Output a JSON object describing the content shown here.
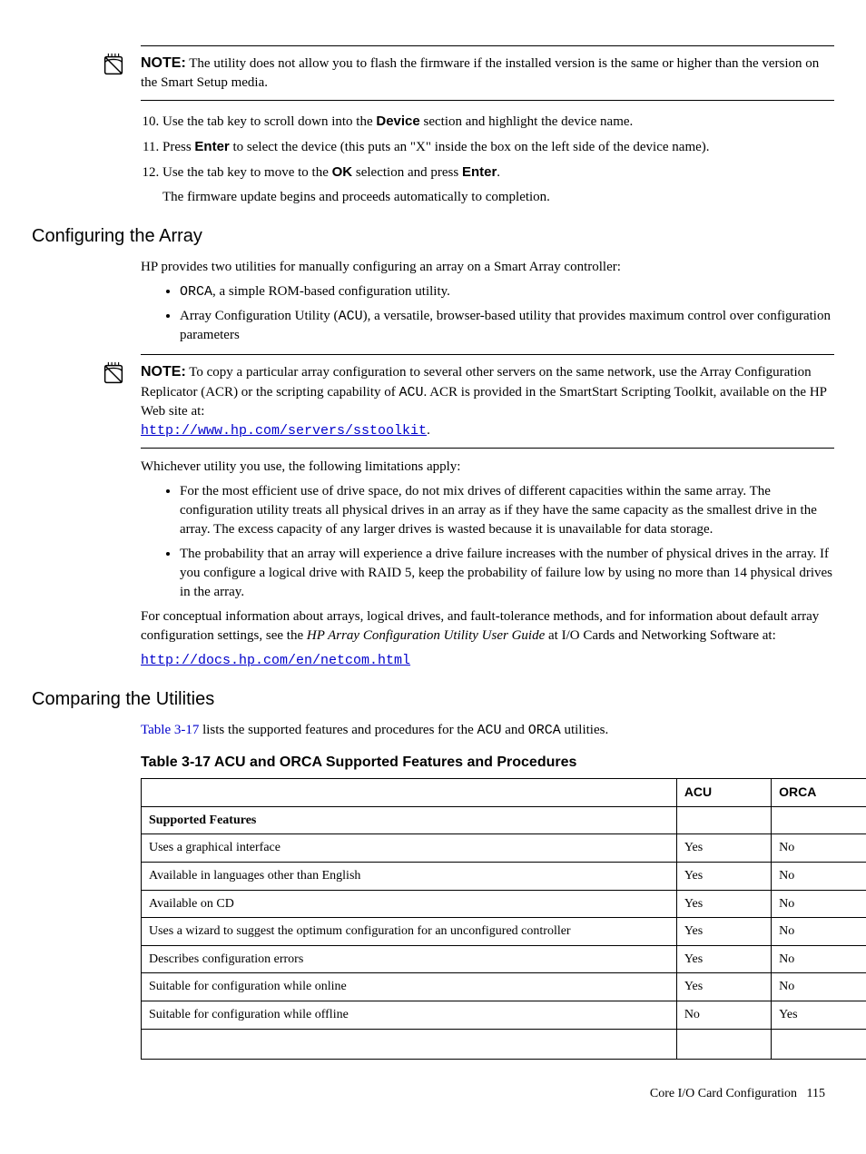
{
  "note1": {
    "label": "NOTE:",
    "text": "The utility does not allow you to flash the firmware if the installed version is the same or higher than the version on the Smart Setup media."
  },
  "steps": {
    "start": 10,
    "s10_a": "Use the tab key to scroll down into the ",
    "s10_bold": "Device",
    "s10_b": " section and highlight the device name.",
    "s11_a": "Press ",
    "s11_bold": "Enter",
    "s11_b": " to select the device (this puts an \"X\" inside the box on the left side of the device name).",
    "s12_a": "Use the tab key to move to the ",
    "s12_bold1": "OK",
    "s12_b": " selection and press ",
    "s12_bold2": "Enter",
    "s12_c": ".",
    "s12_sub": "The firmware update begins and proceeds automatically to completion."
  },
  "section1": {
    "heading": "Configuring the Array",
    "intro": "HP provides two utilities for manually configuring an array on a Smart Array controller:",
    "b1_mono": "ORCA",
    "b1_rest": ", a simple ROM-based configuration utility.",
    "b2_a": "Array Configuration Utility (",
    "b2_mono": "ACU",
    "b2_b": "), a versatile, browser-based utility that provides maximum control over configuration parameters"
  },
  "note2": {
    "label": "NOTE:",
    "text_a": "To copy a particular array configuration to several other servers on the same network, use the Array Configuration Replicator (ACR) or the scripting capability of ",
    "mono": "ACU",
    "text_b": ". ACR is provided in the SmartStart Scripting Toolkit, available on the HP Web site at:",
    "link": "http://www.hp.com/servers/sstoolkit",
    "period": "."
  },
  "limits": {
    "intro": "Whichever utility you use, the following limitations apply:",
    "b1": "For the most efficient use of drive space, do not mix drives of different capacities within the same array. The configuration utility treats all physical drives in an array as if they have the same capacity as the smallest drive in the array. The excess capacity of any larger drives is wasted because it is unavailable for data storage.",
    "b2": "The probability that an array will experience a drive failure increases with the number of physical drives in the array. If you configure a logical drive with RAID 5, keep the probability of failure low by using no more than 14 physical drives in the array.",
    "concept_a": "For conceptual information about arrays, logical drives, and fault-tolerance methods, and for information about default array configuration settings, see the ",
    "concept_italic": "HP Array Configuration Utility User Guide",
    "concept_b": " at I/O Cards and Networking Software at:",
    "link": "http://docs.hp.com/en/netcom.html"
  },
  "section2": {
    "heading": "Comparing the Utilities",
    "intro_xref": "Table 3-17",
    "intro_a": " lists the supported features and procedures for the ",
    "intro_m1": "ACU",
    "intro_b": " and ",
    "intro_m2": "ORCA",
    "intro_c": " utilities."
  },
  "table": {
    "caption": "Table 3-17 ACU and ORCA Supported Features and Procedures",
    "h_blank": "",
    "h_acu": "ACU",
    "h_orca": "ORCA",
    "sub": "Supported Features",
    "rows": [
      {
        "f": "Uses a graphical interface",
        "a": "Yes",
        "o": "No"
      },
      {
        "f": "Available in languages other than English",
        "a": "Yes",
        "o": "No"
      },
      {
        "f": "Available on CD",
        "a": "Yes",
        "o": "No"
      },
      {
        "f": "Uses a wizard to suggest the optimum configuration for an unconfigured controller",
        "a": "Yes",
        "o": "No"
      },
      {
        "f": "Describes configuration errors",
        "a": "Yes",
        "o": "No"
      },
      {
        "f": "Suitable for configuration while online",
        "a": "Yes",
        "o": "No"
      },
      {
        "f": "Suitable for configuration while offline",
        "a": "No",
        "o": "Yes"
      }
    ]
  },
  "footer": {
    "text": "Core I/O Card Configuration",
    "page": "115"
  }
}
